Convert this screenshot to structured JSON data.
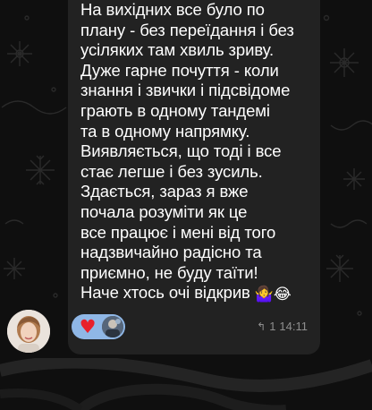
{
  "message": {
    "lines": [
      "На вихідних все було по",
      "плану - без переїдання і без",
      "усіляких там хвиль зриву.",
      "Дуже гарне почуття - коли",
      "знання і звички і підсвідоме",
      "грають в одному тандемі",
      "та в одному напрямку.",
      "Виявляється, що тоді і все",
      "стає легше і без зусиль.",
      "Здається, зараз я вже",
      "почала розуміти як це",
      "все працює і мені від того",
      "надзвичайно радісно та",
      "приємно, не буду таїти!",
      "Наче хтось очі відкрив"
    ],
    "trailing_emojis": "🤷‍♀️😂",
    "reply_count": "1",
    "reply_icon": "↰",
    "time": "14:11"
  },
  "reactions": {
    "heart": "♥",
    "heart_color": "#e8202b",
    "pill_color": "#8fb7e6"
  },
  "colors": {
    "background": "#0f0f0f",
    "bubble": "#222222",
    "text": "#ffffff",
    "meta": "#8e8e8e"
  }
}
